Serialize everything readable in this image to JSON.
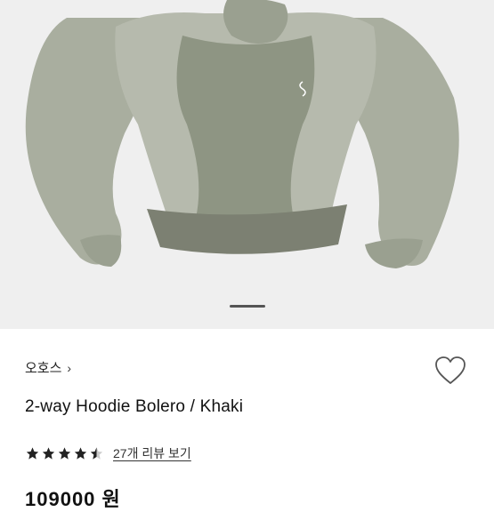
{
  "product": {
    "brand": "오호스",
    "brand_chevron": "›",
    "title": "2-way Hoodie Bolero / Khaki",
    "rating": 4.5,
    "review_link": "27개 리뷰 보기",
    "price": "109000 원"
  },
  "gallery": {
    "image_icon": "khaki-hoodie-bolero-photo",
    "current_slide": 1
  },
  "colors": {
    "image_bg": "#efefef",
    "jacket": "#a9ae9f",
    "jacket_dark": "#8a8f7f",
    "rib": "#7c8072",
    "star": "#222222"
  }
}
